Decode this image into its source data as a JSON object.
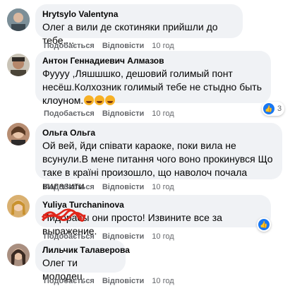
{
  "actions": {
    "like": "Подобається",
    "reply": "Відповісти"
  },
  "comments": [
    {
      "author": "Hrytsylo Valentyna",
      "text": "Олег а вили де скотиняки прийшли до тебе....",
      "time": "10 год"
    },
    {
      "author": "Антон Геннадиевич Алмазов",
      "text": "Фуууу ,Ляшшшко, дешовий голимый понт несёш.Колхозник голимый тебе не стыдно быть клоуном.",
      "time": "10 год",
      "reaction_count": "3"
    },
    {
      "author": "Ольга Ольга",
      "text": "Ой вей, йди співати караоке, поки вила не всунули.В мене питання чого воно прокинувся Що таке в країні произошло, що наволоч почала вилазити",
      "time": "10 год"
    },
    {
      "author": "Yuliya Turchaninova",
      "text_hidden": "Пидорасы",
      "text": "они просто! Извините все за выражение.",
      "time": "10 год"
    },
    {
      "author": "Лильчик Талаверова",
      "text": "Олег ти молодец.",
      "time": "10 год"
    }
  ],
  "colors": {
    "bubble": "#f0f2f5",
    "meta": "#65676b",
    "like": "#1877f2",
    "scribble": "#e0261b"
  }
}
